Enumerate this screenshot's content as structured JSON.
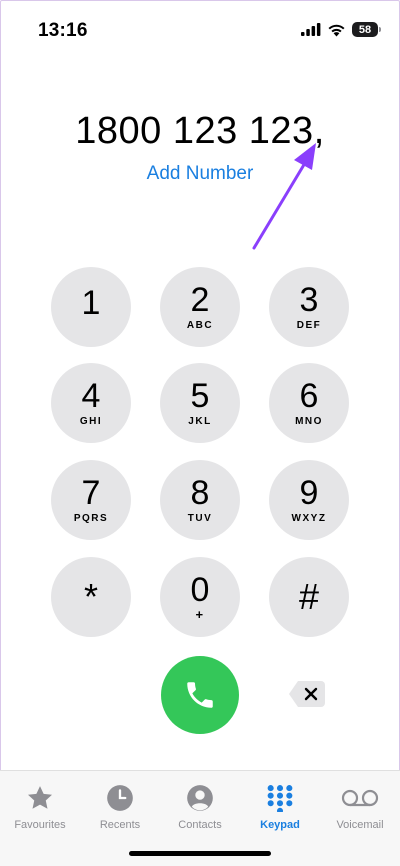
{
  "status_bar": {
    "time": "13:16",
    "battery": "58"
  },
  "dialer": {
    "number": "1800 123 123,",
    "add_number_label": "Add Number"
  },
  "keypad": {
    "keys": [
      {
        "digit": "1",
        "letters": ""
      },
      {
        "digit": "2",
        "letters": "ABC"
      },
      {
        "digit": "3",
        "letters": "DEF"
      },
      {
        "digit": "4",
        "letters": "GHI"
      },
      {
        "digit": "5",
        "letters": "JKL"
      },
      {
        "digit": "6",
        "letters": "MNO"
      },
      {
        "digit": "7",
        "letters": "PQRS"
      },
      {
        "digit": "8",
        "letters": "TUV"
      },
      {
        "digit": "9",
        "letters": "WXYZ"
      },
      {
        "digit": "*",
        "letters": ""
      },
      {
        "digit": "0",
        "letters": "+"
      },
      {
        "digit": "#",
        "letters": ""
      }
    ]
  },
  "tabs": [
    {
      "label": "Favourites",
      "icon": "star-icon"
    },
    {
      "label": "Recents",
      "icon": "clock-icon"
    },
    {
      "label": "Contacts",
      "icon": "person-icon"
    },
    {
      "label": "Keypad",
      "icon": "keypad-icon",
      "active": true
    },
    {
      "label": "Voicemail",
      "icon": "voicemail-icon"
    }
  ],
  "colors": {
    "accent": "#1a7fe0",
    "call_green": "#34c759",
    "key_gray": "#e5e5e7",
    "annotation_purple": "#8a3ffc"
  }
}
